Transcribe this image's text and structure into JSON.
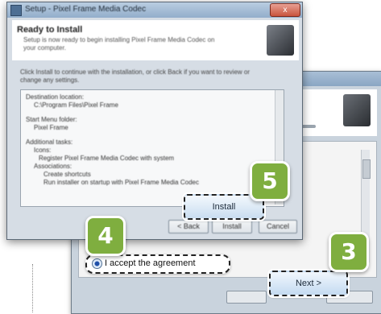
{
  "front_window": {
    "title": "Setup - Pixel Frame Media Codec",
    "close_label": "x",
    "header_title": "Ready to Install",
    "header_subtitle": "Setup is now ready to begin installing Pixel Frame Media Codec on your computer.",
    "intro": "Click Install to continue with the installation, or click Back if you want to review or change any settings.",
    "summary": {
      "dest_heading": "Destination location:",
      "dest_value": "C:\\Program Files\\Pixel Frame",
      "group_heading": "Start Menu folder:",
      "group_value": "Pixel Frame",
      "tasks_heading": "Additional tasks:",
      "tasks_sub": "Icons:",
      "task_1": "Register Pixel Frame Media Codec with system",
      "tasks_sub2": "Associations:",
      "task_2": "Create shortcuts",
      "task_3": "Run installer on startup with Pixel Frame Media Codec"
    },
    "back_label": "< Back",
    "install_small_label": "Install",
    "cancel_label": "Cancel"
  },
  "callouts": {
    "install_label": "Install",
    "agree_label": "I accept the agreement",
    "next_label": "Next >",
    "step_install": "5",
    "step_agree": "4",
    "step_next": "3"
  },
  "colors": {
    "badge_green": "#7fae3f",
    "titlebar_blue": "#93aecb",
    "button_blue": "#c9ddf0"
  },
  "icons": {
    "radio": "radio-selected-icon",
    "installer_logo": "installer-box-icon"
  }
}
